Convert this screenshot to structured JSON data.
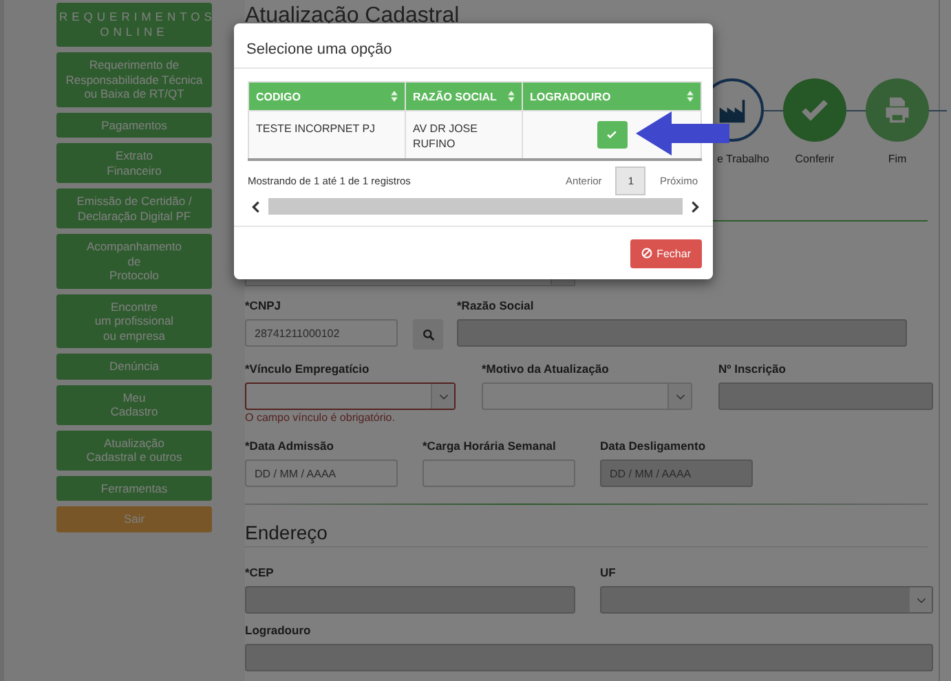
{
  "sidebar": {
    "items": [
      {
        "label": "REQUERIMENTOS ONLINE",
        "kind": "header"
      },
      {
        "label": "Requerimento de\nResponsabilidade Técnica\nou Baixa de RT/QT",
        "kind": "link"
      },
      {
        "label": "Pagamentos",
        "kind": "link"
      },
      {
        "label": "Extrato\nFinanceiro",
        "kind": "link"
      },
      {
        "label": "Emissão de Certidão /\nDeclaração Digital PF",
        "kind": "link"
      },
      {
        "label": "Acompanhamento\nde\nProtocolo",
        "kind": "link"
      },
      {
        "label": "Encontre\num profissional\nou empresa",
        "kind": "link"
      },
      {
        "label": "Denúncia",
        "kind": "link"
      },
      {
        "label": "Meu\nCadastro",
        "kind": "link"
      },
      {
        "label": "Atualização\nCadastral e outros",
        "kind": "link"
      },
      {
        "label": "Ferramentas",
        "kind": "link"
      },
      {
        "label": "Sair",
        "kind": "exit"
      }
    ]
  },
  "page": {
    "title": "Atualização Cadastral"
  },
  "stepper": {
    "steps": [
      {
        "label": "e Trabalho",
        "kind": "factory"
      },
      {
        "label": "Conferir",
        "kind": "check"
      },
      {
        "label": "Fim",
        "kind": "print"
      }
    ]
  },
  "form": {
    "rows": [
      {
        "fields": [
          {
            "label": "*CNPJ",
            "kind": "search",
            "value": "28741211000102",
            "disabled": false
          },
          {
            "label": "*Razão Social",
            "kind": "text",
            "disabled": true
          }
        ]
      },
      {
        "fields": [
          {
            "label": "*Vínculo Empregatício",
            "kind": "select",
            "disabled": false,
            "error": "O campo vínculo é obrigatório."
          },
          {
            "label": "*Motivo da Atualização",
            "kind": "select",
            "disabled": false
          },
          {
            "label": "Nº Inscrição",
            "kind": "text",
            "disabled": true
          }
        ]
      },
      {
        "fields": [
          {
            "label": "*Data Admissão",
            "kind": "text",
            "placeholder": "DD / MM / AAAA",
            "disabled": false
          },
          {
            "label": "*Carga Horária Semanal",
            "kind": "text",
            "disabled": false
          },
          {
            "label": "Data Desligamento",
            "kind": "text",
            "placeholder": "DD / MM / AAAA",
            "disabled": true
          }
        ]
      }
    ]
  },
  "address": {
    "heading": "Endereço",
    "rows": [
      {
        "fields": [
          {
            "label": "*CEP",
            "kind": "text",
            "disabled": true
          },
          {
            "label": "UF",
            "kind": "select",
            "disabled": true
          }
        ]
      },
      {
        "fields": [
          {
            "label": "Logradouro",
            "kind": "text",
            "disabled": true
          }
        ]
      }
    ]
  },
  "modal": {
    "title": "Selecione uma opção",
    "table": {
      "columns": [
        "CODIGO",
        "RAZÃO SOCIAL",
        "LOGRADOURO"
      ],
      "rows": [
        {
          "cells": [
            "TESTE INCORPNET PJ",
            "AV DR JOSE\nRUFINO"
          ]
        }
      ]
    },
    "info": "Mostrando de 1 até 1 de 1 registros",
    "pagination": {
      "previous": "Anterior",
      "pages": [
        {
          "label": "1",
          "selected": true
        }
      ],
      "next": "Próximo"
    },
    "close_button": "Fechar"
  },
  "annotation": {
    "kind": "arrow"
  }
}
